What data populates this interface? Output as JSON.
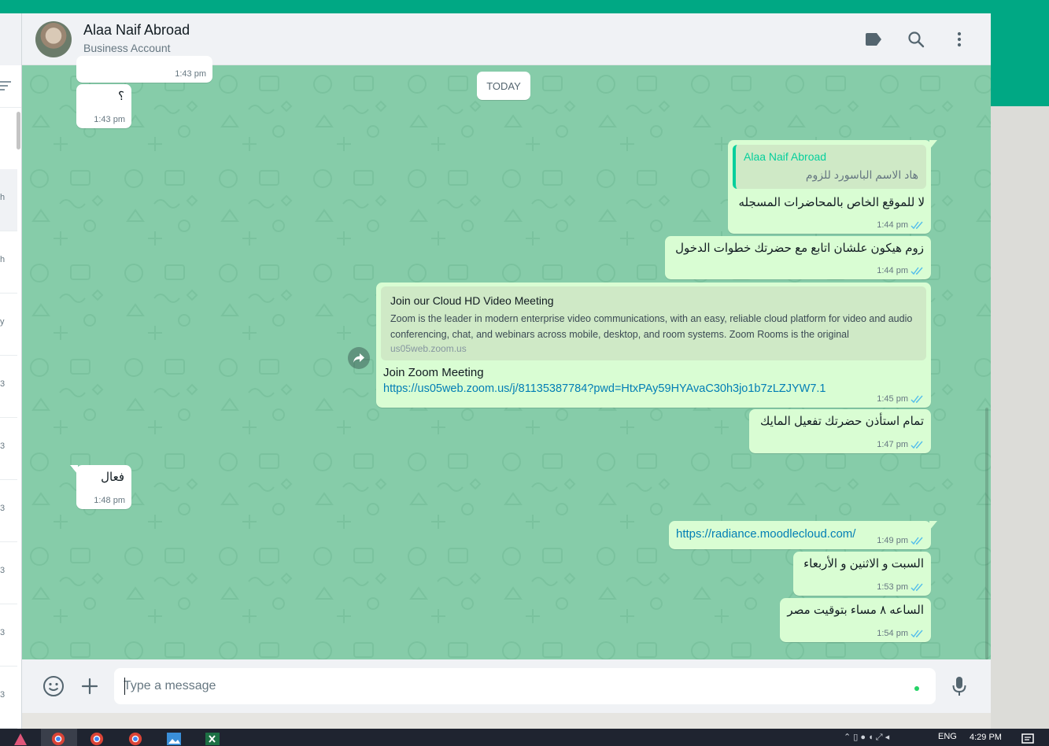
{
  "header": {
    "name": "Alaa Naif Abroad",
    "subtitle": "Business Account",
    "icons": [
      "label-icon",
      "search-icon",
      "more-options-icon"
    ]
  },
  "left_panel": {
    "row_labels": [
      "h",
      "h",
      "y",
      "3",
      "3",
      "3",
      "3",
      "3",
      "3"
    ]
  },
  "day_divider": "TODAY",
  "messages": [
    {
      "id": "m0",
      "dir": "in",
      "text": "",
      "time": "1:43 pm"
    },
    {
      "id": "m1",
      "dir": "in",
      "text": "؟",
      "time": "1:43 pm"
    },
    {
      "id": "m2",
      "dir": "out",
      "quote_author": "Alaa Naif Abroad",
      "quote_text": "هاد الاسم الباسورد للزوم",
      "text": "لا للموقع الخاص بالمحاضرات المسجله",
      "time": "1:44 pm"
    },
    {
      "id": "m3",
      "dir": "out",
      "text": "زوم هيكون علشان اتابع مع حضرتك خطوات الدخول",
      "time": "1:44 pm"
    },
    {
      "id": "m4",
      "dir": "out",
      "preview_title": "Join our Cloud HD Video Meeting",
      "preview_desc": "Zoom is the leader in modern enterprise video communications, with an easy, reliable cloud platform for video and audio conferencing, chat, and webinars across mobile, desktop, and room systems. Zoom Rooms is the original",
      "preview_domain": "us05web.zoom.us",
      "text": "Join Zoom Meeting",
      "link": "https://us05web.zoom.us/j/81135387784?pwd=HtxPAy59HYAvaC30h3jo1b7zLZJYW7.1",
      "time": "1:45 pm"
    },
    {
      "id": "m5",
      "dir": "out",
      "text": "تمام استأذن حضرتك تفعيل المايك",
      "time": "1:47 pm"
    },
    {
      "id": "m6",
      "dir": "in",
      "text": "فعال",
      "time": "1:48 pm"
    },
    {
      "id": "m7",
      "dir": "out",
      "link": "https://radiance.moodlecloud.com/",
      "time": "1:49 pm"
    },
    {
      "id": "m8",
      "dir": "out",
      "text": "السبت و الاثنين و الأربعاء",
      "time": "1:53 pm"
    },
    {
      "id": "m9",
      "dir": "out",
      "text": "الساعه ٨ مساء بتوقيت مصر",
      "time": "1:54 pm"
    }
  ],
  "composer": {
    "placeholder": "Type a message",
    "icons": [
      "emoji-icon",
      "attach-plus-icon",
      "microphone-icon"
    ]
  },
  "taskbar": {
    "language": "ENG",
    "time": "4:29 PM"
  },
  "colors": {
    "brand": "#00a884",
    "chat_bg": "#86cca9",
    "outgoing_bubble": "#d9fdd3",
    "incoming_bubble": "#ffffff",
    "link": "#027eb5",
    "read_ticks": "#53bdeb"
  }
}
